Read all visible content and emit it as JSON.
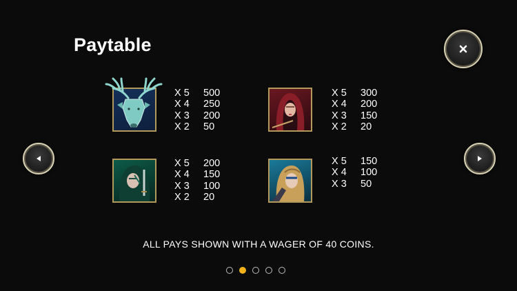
{
  "header": {
    "title": "Paytable"
  },
  "buttons": {
    "close_icon": "close-icon",
    "prev_icon": "chevron-left-icon",
    "next_icon": "chevron-right-icon"
  },
  "symbols": [
    {
      "name": "stag",
      "pays": [
        {
          "mult": "X 5",
          "value": "500"
        },
        {
          "mult": "X 4",
          "value": "250"
        },
        {
          "mult": "X 3",
          "value": "200"
        },
        {
          "mult": "X 2",
          "value": "50"
        }
      ]
    },
    {
      "name": "hooded-archer",
      "pays": [
        {
          "mult": "X 5",
          "value": "300"
        },
        {
          "mult": "X 4",
          "value": "200"
        },
        {
          "mult": "X 3",
          "value": "150"
        },
        {
          "mult": "X 2",
          "value": "20"
        }
      ]
    },
    {
      "name": "green-warrior",
      "pays": [
        {
          "mult": "X 5",
          "value": "200"
        },
        {
          "mult": "X 4",
          "value": "150"
        },
        {
          "mult": "X 3",
          "value": "100"
        },
        {
          "mult": "X 2",
          "value": "20"
        }
      ]
    },
    {
      "name": "blue-warrior",
      "pays": [
        {
          "mult": "X 5",
          "value": "150"
        },
        {
          "mult": "X 4",
          "value": "100"
        },
        {
          "mult": "X 3",
          "value": "50"
        }
      ]
    }
  ],
  "footer": {
    "note": "ALL PAYS SHOWN WITH A WAGER OF 40 COINS."
  },
  "pagination": {
    "total": 5,
    "active_index": 1
  },
  "colors": {
    "active_dot": "#f2b21c",
    "frame_gold": "#b49a5a",
    "background": "#0b0b0b"
  }
}
